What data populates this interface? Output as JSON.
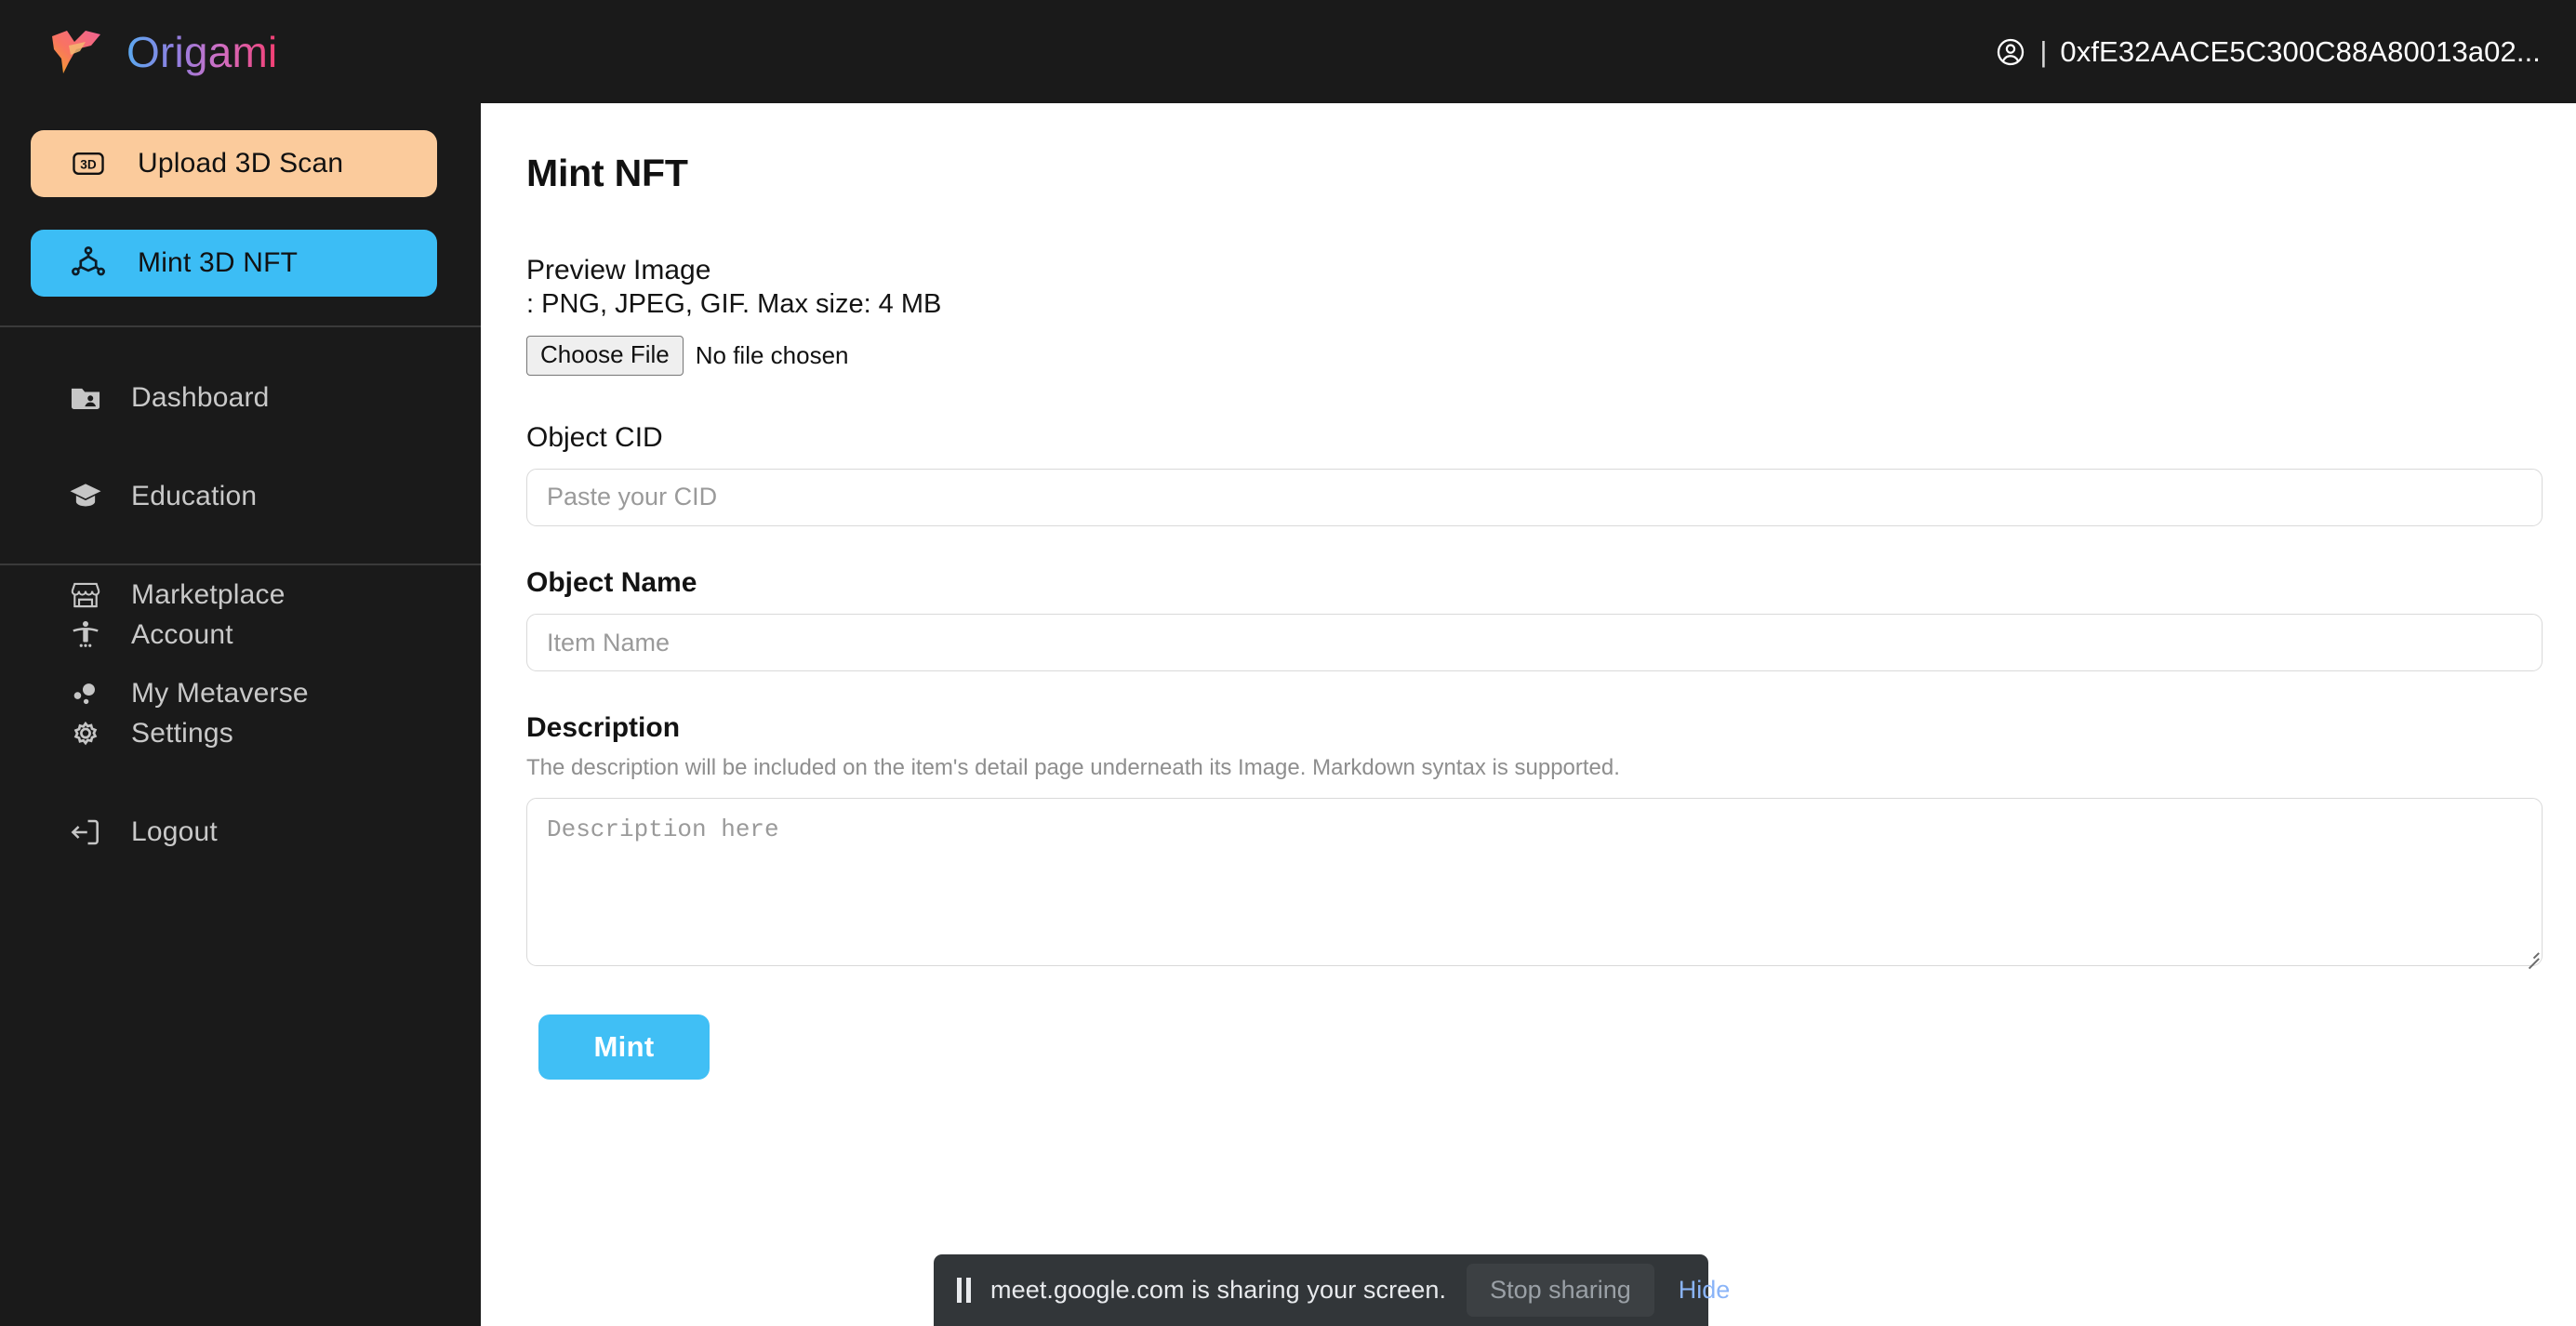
{
  "header": {
    "brand_name": "Origami",
    "brand_logo_icon": "origami-bird-logo",
    "account_icon": "account-circle-icon",
    "separator": "|",
    "wallet_address": "0xfE32AACE5C300C88A80013a02...",
    "brand_gradient_start": "#5aa9f0",
    "brand_gradient_end": "#f43f72",
    "background": "#1a1a1a"
  },
  "sidebar": {
    "background": "#1a1a1a",
    "actions": [
      {
        "label": "Upload 3D Scan",
        "icon": "3d-box-icon",
        "color": "#fbcb9c"
      },
      {
        "label": "Mint 3D NFT",
        "icon": "molecule-network-icon",
        "color": "#3cbdf5"
      }
    ],
    "nav_main": [
      {
        "label": "Dashboard",
        "icon": "folder-person-icon"
      },
      {
        "label": "Education",
        "icon": "graduation-cap-icon"
      },
      {
        "label": "Marketplace",
        "icon": "storefront-icon"
      },
      {
        "label": "My Metaverse",
        "icon": "bubbles-icon"
      }
    ],
    "nav_bottom": [
      {
        "label": "Account",
        "icon": "person-accessibility-icon"
      },
      {
        "label": "Settings",
        "icon": "gear-icon"
      },
      {
        "label": "Logout",
        "icon": "logout-arrow-icon"
      }
    ]
  },
  "main": {
    "page_title": "Mint NFT",
    "preview_image": {
      "label": "Preview Image",
      "hint": ": PNG, JPEG, GIF. Max size: 4 MB",
      "choose_file_label": "Choose File",
      "file_status": "No file chosen"
    },
    "object_cid": {
      "label": "Object CID",
      "placeholder": "Paste your CID",
      "value": ""
    },
    "object_name": {
      "label": "Object Name",
      "placeholder": "Item Name",
      "value": ""
    },
    "description": {
      "label": "Description",
      "hint": "The description will be included on the item's detail page underneath its Image. Markdown syntax is supported.",
      "placeholder": "Description here",
      "value": ""
    },
    "mint_button": {
      "label": "Mint",
      "color": "#40bff5"
    }
  },
  "share_bar": {
    "pause_icon": "pause-icon",
    "message": "meet.google.com is sharing your screen.",
    "stop_label": "Stop sharing",
    "hide_label": "Hide",
    "background": "#323639",
    "hide_color": "#8ab4f8"
  }
}
